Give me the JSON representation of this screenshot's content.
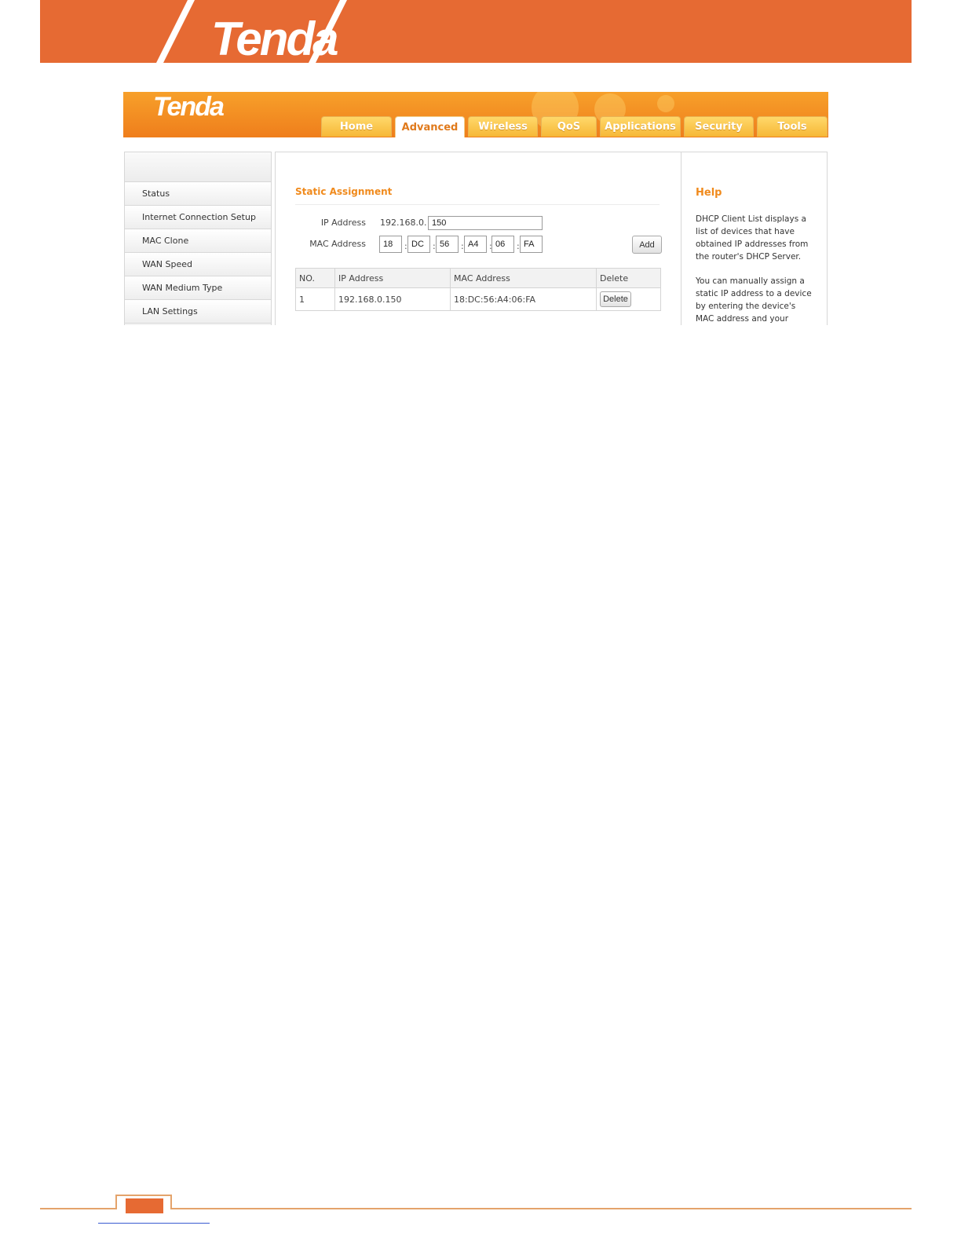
{
  "doc": {
    "logo_text": "Tenda"
  },
  "shot": {
    "logo_text": "Tenda",
    "tabs": [
      {
        "label": "Home"
      },
      {
        "label": "Advanced"
      },
      {
        "label": "Wireless"
      },
      {
        "label": "QoS"
      },
      {
        "label": "Applications"
      },
      {
        "label": "Security"
      },
      {
        "label": "Tools"
      }
    ],
    "active_tab": "Advanced",
    "sidebar": [
      {
        "label": "Status"
      },
      {
        "label": "Internet Connection Setup"
      },
      {
        "label": "MAC Clone"
      },
      {
        "label": "WAN Speed"
      },
      {
        "label": "WAN Medium Type"
      },
      {
        "label": "LAN Settings"
      }
    ],
    "main": {
      "section_title": "Static Assignment",
      "ip_label": "IP Address",
      "ip_prefix": "192.168.0.",
      "ip_value": "150",
      "mac_label": "MAC Address",
      "mac_parts": [
        "18",
        "DC",
        "56",
        "A4",
        "06",
        "FA"
      ],
      "mac_separator": ":",
      "add_label": "Add",
      "table": {
        "headers": [
          "NO.",
          "IP Address",
          "MAC Address",
          "Delete"
        ],
        "rows": [
          {
            "no": "1",
            "ip": "192.168.0.150",
            "mac": "18:DC:56:A4:06:FA",
            "delete_label": "Delete"
          }
        ]
      }
    },
    "help": {
      "title": "Help",
      "p1": "DHCP Client List displays a list of devices that have obtained IP addresses from the router's DHCP Server.",
      "p2": "You can manually assign a static IP address to a device by entering the device's MAC address and your"
    }
  },
  "colors": {
    "brand_orange": "#e66a33",
    "tab_gold": "#f6b737",
    "title_orange": "#f08a1c"
  }
}
